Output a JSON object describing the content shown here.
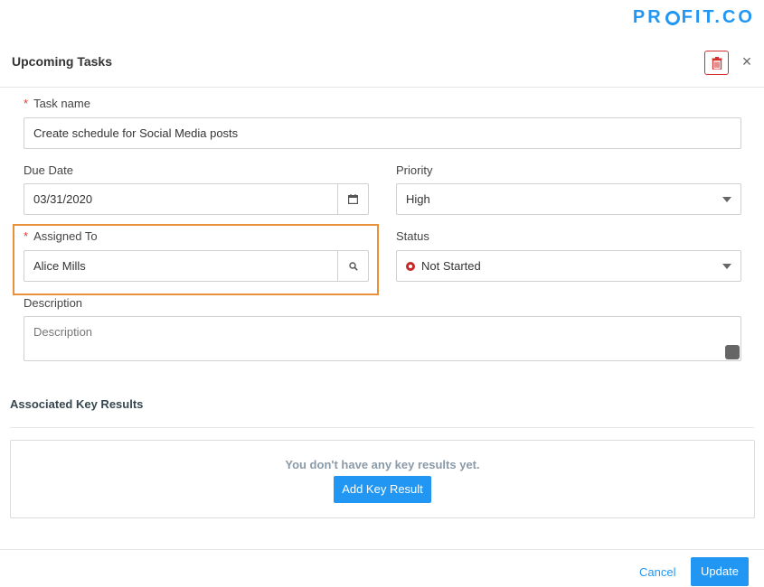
{
  "brand": {
    "logo_left": "PR",
    "logo_right": "FIT.CO",
    "color": "#2196f3"
  },
  "header": {
    "title": "Upcoming Tasks",
    "delete_icon": "trash-icon",
    "close_label": "×"
  },
  "form": {
    "task_name": {
      "label": "Task name",
      "required": "*",
      "value": "Create schedule for Social Media posts"
    },
    "due_date": {
      "label": "Due Date",
      "value": "03/31/2020",
      "icon": "calendar-icon"
    },
    "priority": {
      "label": "Priority",
      "value": "High",
      "icon": "chevron-down-icon"
    },
    "assigned_to": {
      "label": "Assigned To",
      "required": "*",
      "value": "Alice Mills",
      "icon": "search-icon"
    },
    "status": {
      "label": "Status",
      "value": "Not Started",
      "status_color": "#c62828",
      "icon": "chevron-down-icon"
    },
    "description": {
      "label": "Description",
      "placeholder": "Description"
    }
  },
  "key_results": {
    "title": "Associated Key Results",
    "empty_message": "You don't have any key results yet.",
    "add_button": "Add Key Result"
  },
  "footer": {
    "cancel": "Cancel",
    "update": "Update"
  },
  "colors": {
    "accent": "#2196f3",
    "danger": "#d32f2f",
    "highlight": "#e8903a"
  }
}
